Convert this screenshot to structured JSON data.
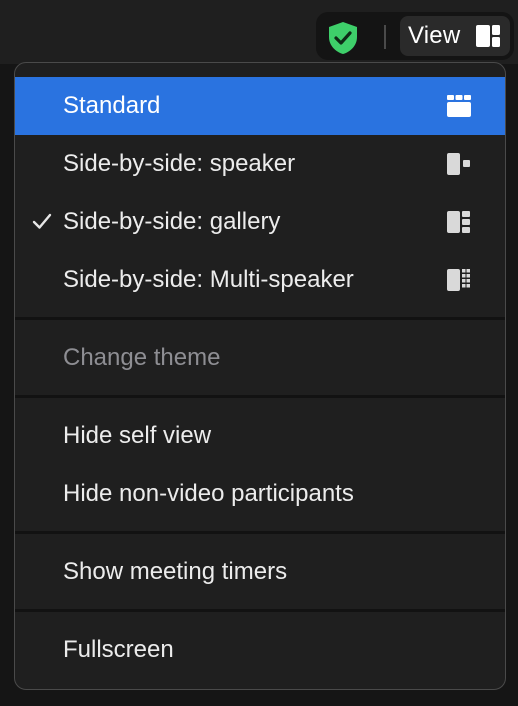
{
  "toolbar": {
    "view_label": "View",
    "shield_color": "#3ecf6a",
    "layout_icon": "sidebar-layout-icon"
  },
  "menu": {
    "selected_color": "#2a73e0",
    "layout_section": [
      {
        "label": "Standard",
        "icon": "grid-standard-icon",
        "highlighted": true,
        "checked": false
      },
      {
        "label": "Side-by-side: speaker",
        "icon": "side-by-side-speaker-icon",
        "highlighted": false,
        "checked": false
      },
      {
        "label": "Side-by-side: gallery",
        "icon": "side-by-side-gallery-icon",
        "highlighted": false,
        "checked": true
      },
      {
        "label": "Side-by-side: Multi-speaker",
        "icon": "side-by-side-multispeaker-icon",
        "highlighted": false,
        "checked": false
      }
    ],
    "theme_section": [
      {
        "label": "Change theme",
        "disabled": true
      }
    ],
    "participants_section": [
      {
        "label": "Hide self view"
      },
      {
        "label": "Hide non-video participants"
      }
    ],
    "timers_section": [
      {
        "label": "Show meeting timers"
      }
    ],
    "screen_section": [
      {
        "label": "Fullscreen"
      }
    ]
  }
}
